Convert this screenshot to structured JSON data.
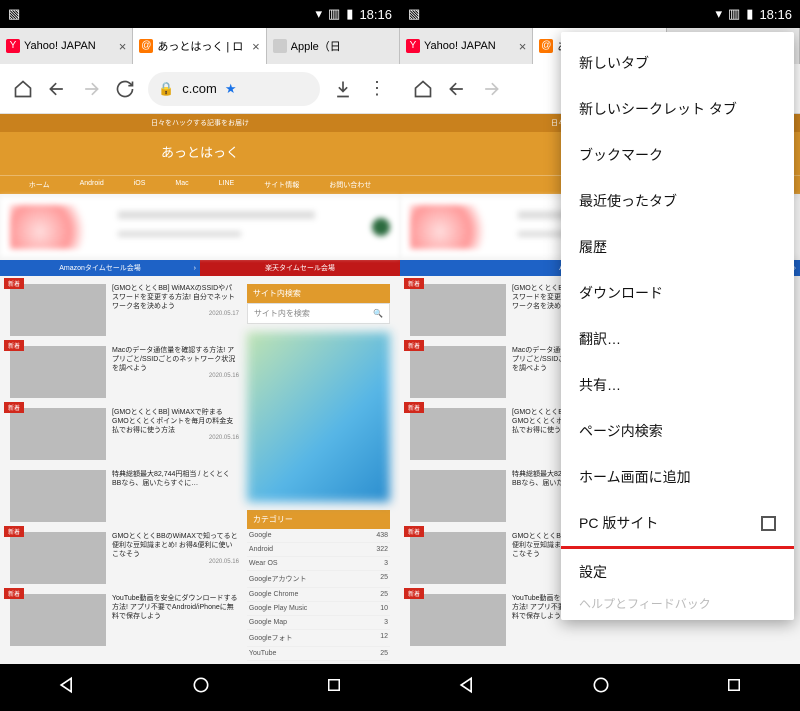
{
  "status": {
    "time": "18:16",
    "icons": [
      "picture-icon",
      "wifi-icon",
      "no-sim-icon",
      "battery-icon"
    ]
  },
  "tabs": [
    {
      "favType": "fav-y",
      "title": "Yahoo! JAPAN",
      "active": false
    },
    {
      "favType": "fav-at",
      "title": "あっとはっく | ロ",
      "active": true
    },
    {
      "favType": "fav-ap",
      "title": "Apple（日",
      "active": false
    }
  ],
  "omnibox": {
    "domain": "c.com"
  },
  "site": {
    "tagline": "日々をハックする記事をお届け",
    "name": "あっとはっく",
    "nav": [
      "ホーム",
      "Android",
      "iOS",
      "Mac",
      "LINE",
      "サイト情報",
      "お問い合わせ"
    ]
  },
  "salebar": {
    "blue": "Amazonタイムセール会場",
    "red": "楽天タイムセール会場"
  },
  "articles": [
    {
      "th": "th1",
      "badge": "新着",
      "title": "[GMOとくとくBB] WiMAXのSSIDやパスワードを変更する方法! 自分でネットワーク名を決めよう",
      "date": "2020.05.17"
    },
    {
      "th": "th2",
      "badge": "新着",
      "title": "Macのデータ通信量を確認する方法! アプリごと/SSIDごとのネットワーク状況を調べよう",
      "date": "2020.05.16"
    },
    {
      "th": "th3",
      "badge": "新着",
      "title": "[GMOとくとくBB] WiMAXで貯まるGMOとくとくポイントを毎月の料金支払でお得に使う方法",
      "date": "2020.05.16"
    },
    {
      "th": "th4",
      "badge": "",
      "title": "特典総額最大82,744円相当 / とくとくBBなら、届いたらすぐに…",
      "date": ""
    },
    {
      "th": "th5",
      "badge": "新着",
      "title": "GMOとくとくBBのWiMAXで知ってると便利な豆知識まとめ! お得&便利に使いこなそう",
      "date": "2020.05.16"
    },
    {
      "th": "th6",
      "badge": "新着",
      "title": "YouTube動画を安全にダウンロードする方法! アプリ不要でAndroid/iPhoneに無料で保存しよう",
      "date": ""
    }
  ],
  "sidebar": {
    "search_header": "サイト内検索",
    "search_placeholder": "サイト内を検索",
    "cat_header": "カテゴリー",
    "cats": [
      {
        "name": "Google",
        "count": "438"
      },
      {
        "name": "Android",
        "count": "322"
      },
      {
        "name": "Wear OS",
        "count": "3"
      },
      {
        "name": "Googleアカウント",
        "count": "25"
      },
      {
        "name": "Google Chrome",
        "count": "25"
      },
      {
        "name": "Google Play Music",
        "count": "10"
      },
      {
        "name": "Google Map",
        "count": "3"
      },
      {
        "name": "Googleフォト",
        "count": "12"
      },
      {
        "name": "YouTube",
        "count": "25"
      }
    ]
  },
  "menu": [
    "新しいタブ",
    "新しいシークレット タブ",
    "ブックマーク",
    "最近使ったタブ",
    "履歴",
    "ダウンロード",
    "翻訳…",
    "共有…",
    "ページ内検索",
    "ホーム画面に追加",
    "PC 版サイト",
    "設定"
  ],
  "menu_truncated": "ヘルプとフィードバック"
}
